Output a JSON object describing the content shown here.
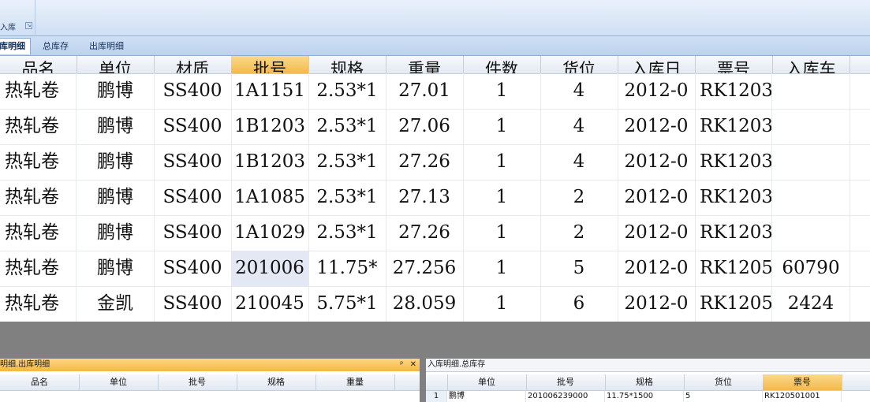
{
  "ribbon": {
    "group_label": "入库",
    "launcher_icon": "dialog-launcher-icon"
  },
  "tabs": [
    {
      "label": "库明细",
      "active": true
    },
    {
      "label": "总库存",
      "active": false
    },
    {
      "label": "出库明细",
      "active": false
    }
  ],
  "grid": {
    "columns": [
      "品名",
      "单位",
      "材质",
      "批号",
      "规格",
      "重量",
      "件数",
      "货位",
      "入库日",
      "票号",
      "入库车"
    ],
    "sorted_column": "批号",
    "rows": [
      [
        "热轧卷",
        "鹏博",
        "SS400",
        "1A1151",
        "2.53*1",
        "27.01",
        "1",
        "4",
        "2012-0",
        "RK1203",
        ""
      ],
      [
        "热轧卷",
        "鹏博",
        "SS400",
        "1B1203",
        "2.53*1",
        "27.06",
        "1",
        "4",
        "2012-0",
        "RK1203",
        ""
      ],
      [
        "热轧卷",
        "鹏博",
        "SS400",
        "1B1203",
        "2.53*1",
        "27.26",
        "1",
        "4",
        "2012-0",
        "RK1203",
        ""
      ],
      [
        "热轧卷",
        "鹏博",
        "SS400",
        "1A1085",
        "2.53*1",
        "27.13",
        "1",
        "2",
        "2012-0",
        "RK1203",
        ""
      ],
      [
        "热轧卷",
        "鹏博",
        "SS400",
        "1A1029",
        "2.53*1",
        "27.26",
        "1",
        "2",
        "2012-0",
        "RK1203",
        ""
      ],
      [
        "热轧卷",
        "鹏博",
        "SS400",
        "201006",
        "11.75*",
        "27.256",
        "1",
        "5",
        "2012-0",
        "RK1205",
        "60790"
      ],
      [
        "热轧卷",
        "金凯",
        "SS400",
        "210045",
        "5.75*1",
        "28.059",
        "1",
        "6",
        "2012-0",
        "RK1205",
        "2424"
      ]
    ]
  },
  "panel_left": {
    "title": "明细.出库明细",
    "pin_icon": "pin-icon",
    "close_icon": "close-icon",
    "columns": [
      "品名",
      "单位",
      "批号",
      "规格",
      "重量"
    ]
  },
  "panel_right": {
    "title": "入库明细.总库存",
    "columns": [
      "单位",
      "批号",
      "规格",
      "货位",
      "票号"
    ],
    "sorted_column": "票号",
    "rows": [
      [
        "1",
        "鹏博",
        "201006239000",
        "11.75*1500",
        "5",
        "RK120501001"
      ]
    ]
  }
}
